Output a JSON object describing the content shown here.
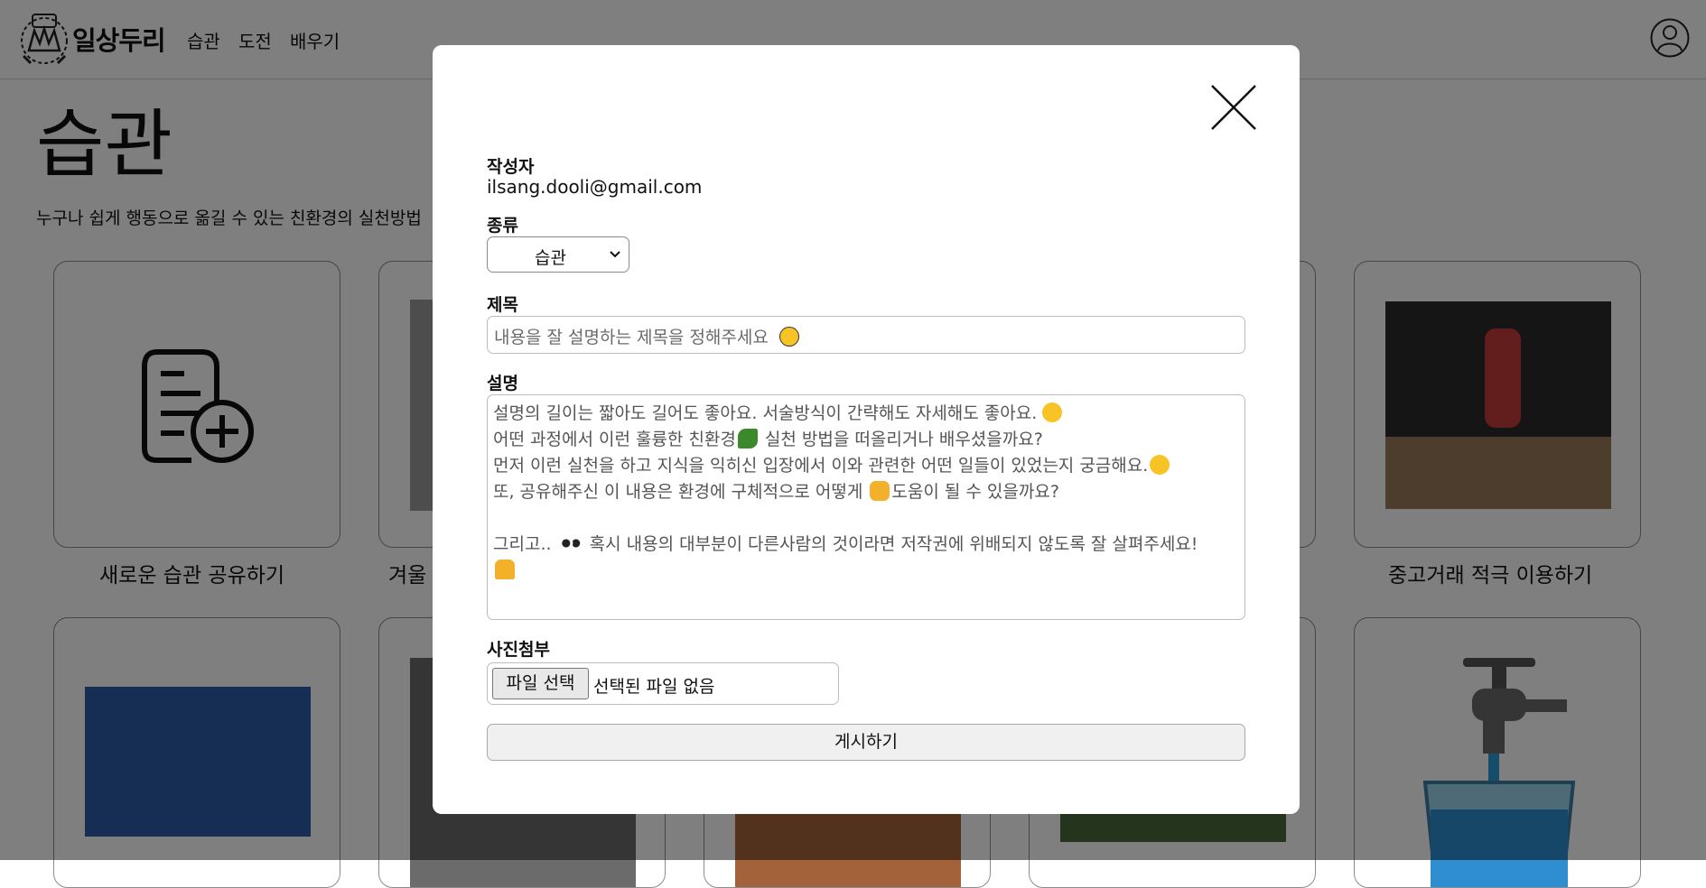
{
  "header": {
    "brand": "일상두리",
    "nav": [
      "습관",
      "도전",
      "배우기"
    ]
  },
  "page": {
    "title": "습관",
    "description": "누구나 쉽게 행동으로 옮길 수 있는 친환경의 실천방법"
  },
  "cards": {
    "new_card_label": "새로운 습관 공유하기",
    "card2_label": "겨울",
    "card_last_label": "중고거래 적극 이용하기"
  },
  "modal": {
    "author_label": "작성자",
    "author_value": "ilsang.dooli@gmail.com",
    "category_label": "종류",
    "category_value": "습관",
    "title_label": "제목",
    "title_placeholder": "내용을 잘 설명하는 제목을 정해주세요",
    "desc_label": "설명",
    "desc_lines": [
      "설명의 길이는 짧아도 길어도 좋아요. 서술방식이 간략해도 자세해도 좋아요.",
      "어떤 과정에서 이런 훌륭한 친환경",
      " 실천 방법을 떠올리거나 배우셨을까요?",
      "먼저 이런 실천을 하고 지식을 익히신 입장에서 이와 관련한 어떤 일들이 있었는지 궁금해요.",
      "또, 공유해주신 이 내용은 환경에 구체적으로 어떻게",
      "도움이 될 수 있을까요?",
      "그리고..",
      " 혹시 내용의 대부분이 다른사람의 것이라면 저작권에 위배되지 않도록 잘 살펴주세요!"
    ],
    "photo_label": "사진첨부",
    "file_button": "파일 선택",
    "file_status": "선택된 파일 없음",
    "submit": "게시하기"
  },
  "colors": {
    "overlay": "#000000",
    "emoji_yellow": "#f7c325",
    "leaf_green": "#3a8a2c"
  }
}
